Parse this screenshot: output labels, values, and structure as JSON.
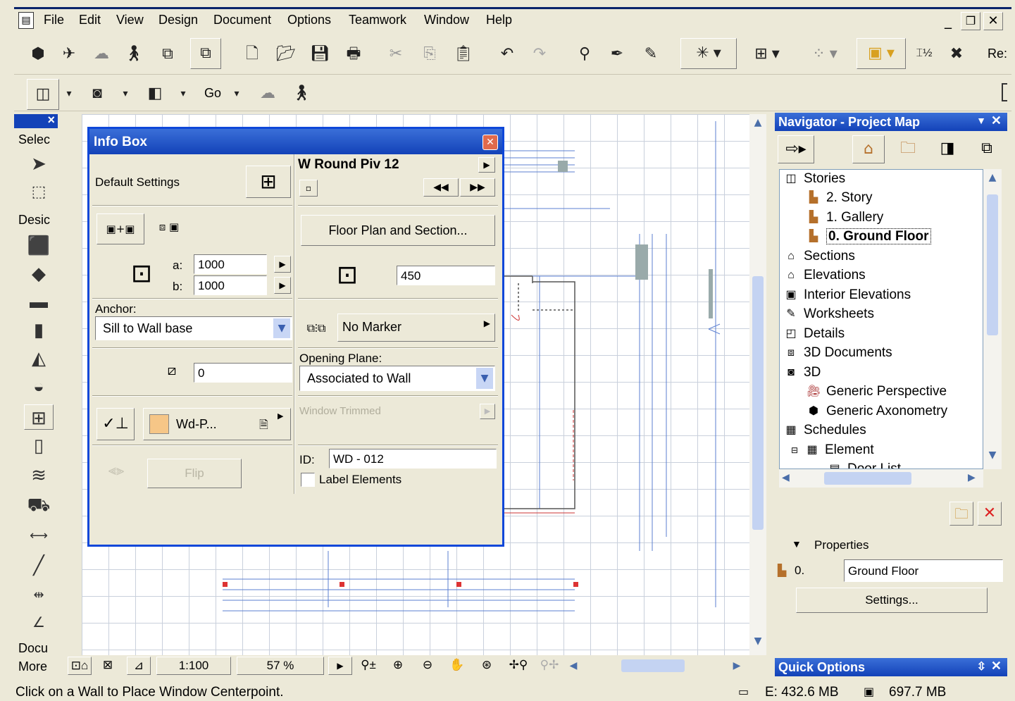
{
  "menu": [
    "File",
    "Edit",
    "View",
    "Design",
    "Document",
    "Options",
    "Teamwork",
    "Window",
    "Help"
  ],
  "toolbar_right_text": "Re:",
  "toolbar2": {
    "go_label": "Go"
  },
  "palette": {
    "close": "×",
    "select_label": "Selec",
    "design_label": "Desic",
    "document_label": "Docu",
    "more_label": "More"
  },
  "infobox": {
    "title": "Info Box",
    "default_settings": "Default Settings",
    "element_name": "W Round Piv 12",
    "floor_plan_button": "Floor Plan and Section...",
    "a_label": "a:",
    "a_value": "1000",
    "b_label": "b:",
    "b_value": "1000",
    "height_value": "450",
    "anchor_label": "Anchor:",
    "anchor_value": "Sill to Wall base",
    "marker_value": "No Marker",
    "sill_value": "0",
    "opening_plane_label": "Opening Plane:",
    "opening_plane_value": "Associated to Wall",
    "window_trimmed": "Window Trimmed",
    "pen_label": "Wd-P...",
    "flip_label": "Flip",
    "id_label": "ID:",
    "id_value": "WD - 012",
    "label_elements": "Label Elements"
  },
  "navigator": {
    "title": "Navigator - Project Map",
    "tree": [
      {
        "label": "Stories",
        "level": 0,
        "icon": "stories-icon"
      },
      {
        "label": "2. Story",
        "level": 1,
        "icon": "story-folder-icon"
      },
      {
        "label": "1. Gallery",
        "level": 1,
        "icon": "story-folder-icon"
      },
      {
        "label": "0. Ground Floor",
        "level": 1,
        "icon": "story-folder-icon",
        "selected": true
      },
      {
        "label": "Sections",
        "level": 0,
        "icon": "sections-icon"
      },
      {
        "label": "Elevations",
        "level": 0,
        "icon": "elevations-icon"
      },
      {
        "label": "Interior Elevations",
        "level": 0,
        "icon": "interior-elevations-icon"
      },
      {
        "label": "Worksheets",
        "level": 0,
        "icon": "worksheets-icon"
      },
      {
        "label": "Details",
        "level": 0,
        "icon": "details-icon"
      },
      {
        "label": "3D Documents",
        "level": 0,
        "icon": "3d-documents-icon"
      },
      {
        "label": "3D",
        "level": 0,
        "icon": "3d-icon"
      },
      {
        "label": "Generic Perspective",
        "level": 1,
        "icon": "camera-icon"
      },
      {
        "label": "Generic Axonometry",
        "level": 1,
        "icon": "axonometry-icon"
      },
      {
        "label": "Schedules",
        "level": 0,
        "icon": "schedules-icon"
      },
      {
        "label": "Element",
        "level": 1,
        "icon": "element-icon"
      },
      {
        "label": "Door List",
        "level": 2,
        "icon": "list-icon"
      }
    ],
    "properties_label": "Properties",
    "prop_number": "0.",
    "prop_name": "Ground Floor",
    "settings_button": "Settings...",
    "quick_options": "Quick Options"
  },
  "bottom": {
    "scale": "1:100",
    "zoom": "57 %"
  },
  "status": {
    "message": "Click on a Wall to Place Window Centerpoint.",
    "mem_e": "E: 432.6 MB",
    "mem_total": "697.7 MB"
  }
}
